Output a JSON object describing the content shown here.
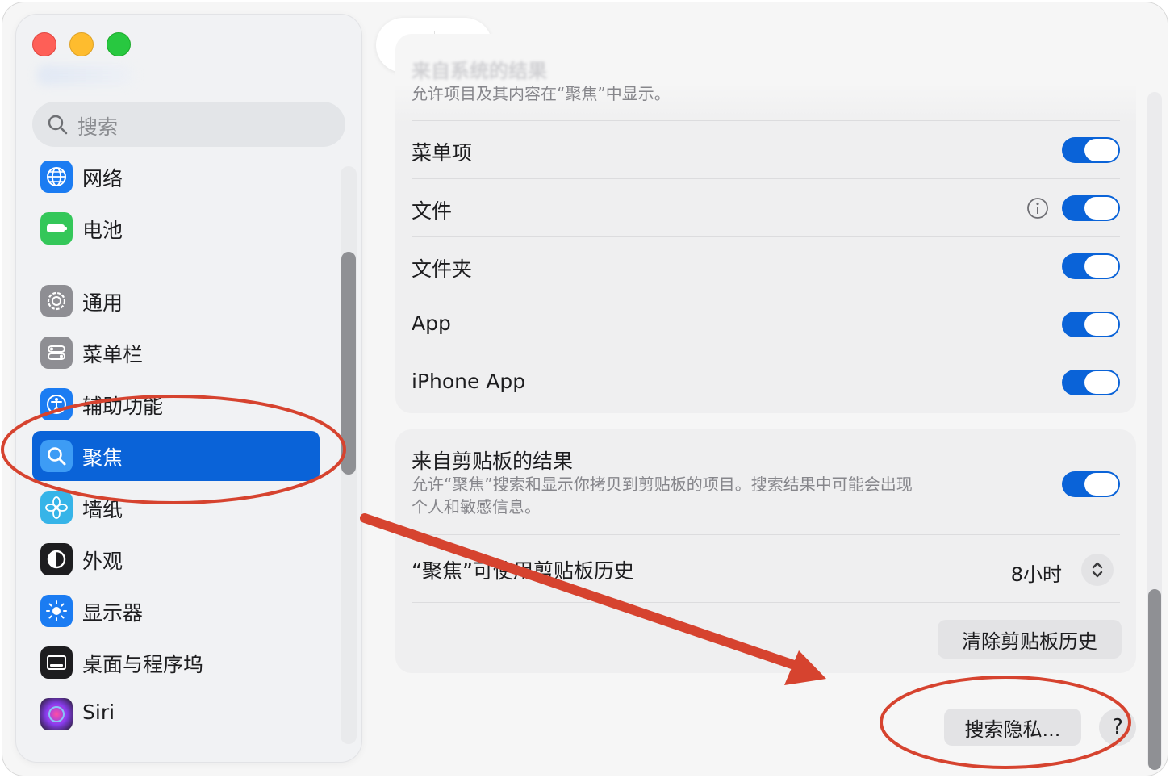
{
  "window": {
    "title": "聚焦"
  },
  "sidebar": {
    "search_placeholder": "搜索",
    "items": [
      {
        "label": "网络",
        "icon": "globe-icon",
        "color": "#1b7cf2"
      },
      {
        "label": "电池",
        "icon": "battery-icon",
        "color": "#34c759"
      },
      {
        "label": "通用",
        "icon": "gear-icon",
        "color": "#8e8e93"
      },
      {
        "label": "菜单栏",
        "icon": "menubar-icon",
        "color": "#8e8e93"
      },
      {
        "label": "辅助功能",
        "icon": "accessibility-icon",
        "color": "#1b7cf2"
      },
      {
        "label": "聚焦",
        "icon": "spotlight-icon",
        "color": "#1b7cf2",
        "selected": true
      },
      {
        "label": "墙纸",
        "icon": "flower-icon",
        "color": "#36b4e8"
      },
      {
        "label": "外观",
        "icon": "appearance-icon",
        "color": "#1d1d1f"
      },
      {
        "label": "显示器",
        "icon": "sun-icon",
        "color": "#1b7cf2"
      },
      {
        "label": "桌面与程序坞",
        "icon": "dock-icon",
        "color": "#1d1d1f"
      },
      {
        "label": "Siri",
        "icon": "siri-icon",
        "color": "#5a3ed1"
      }
    ]
  },
  "content": {
    "faded_heading": "来自系统的结果",
    "faded_description": "允许项目及其内容在“聚焦”中显示。",
    "results": [
      {
        "label": "菜单项",
        "enabled": true
      },
      {
        "label": "文件",
        "enabled": true,
        "info": true
      },
      {
        "label": "文件夹",
        "enabled": true
      },
      {
        "label": "App",
        "enabled": true
      },
      {
        "label": "iPhone App",
        "enabled": true
      }
    ],
    "clipboard": {
      "title": "来自剪贴板的结果",
      "description_line1": "允许“聚焦”搜索和显示你拷贝到剪贴板的项目。搜索结果中可能会出现",
      "description_line2": "个人和敏感信息。",
      "enabled": true,
      "history_label": "“聚焦”可使用剪贴板历史",
      "history_value": "8小时",
      "clear_button": "清除剪贴板历史"
    },
    "privacy_button": "搜索隐私...",
    "help_button": "?"
  },
  "colors": {
    "accent": "#0a63d8",
    "annotation": "#d6432f"
  }
}
